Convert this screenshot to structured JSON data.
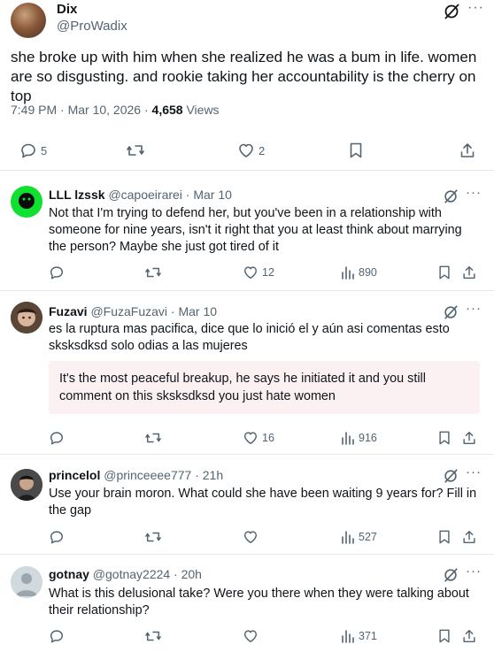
{
  "main": {
    "name": "Dix",
    "handle": "@ProWadix",
    "text": "she broke up with him when she realized he was a bum in life. women are so disgusting. and rookie taking her accountability is the cherry on top",
    "time": "7:49 PM · Mar 10, 2026 · ",
    "views_count": "4,658",
    "views_label": " Views",
    "replies": "5",
    "likes": "2"
  },
  "replies": [
    {
      "name": "LLL lzssk",
      "handle_time": "@capoeirarei · Mar 10",
      "text": "Not that I'm trying to defend her, but you've been in a relationship with someone for nine years, isn't it right that you at least think about marrying the person? Maybe she just got tired of it",
      "likes": "12",
      "views": "890"
    },
    {
      "name": "Fuzavi",
      "handle_time": "@FuzaFuzavi · Mar 10",
      "text": "es la ruptura mas pacifica, dice que lo inició el y aún asi comentas esto sksksdksd solo odias a las mujeres",
      "translation": "It's the most peaceful breakup, he says he initiated it and you still comment on this sksksdksd you just hate women",
      "likes": "16",
      "views": "916"
    },
    {
      "name": "princelol",
      "handle_time": "@princeeee777 · 21h",
      "text": "Use your brain moron. What could she have been waiting 9 years for? Fill in the gap",
      "views": "527"
    },
    {
      "name": "gotnay",
      "handle_time": "@gotnay2224 · 20h",
      "text": "What is this delusional take? Were you there when they were talking about their relationship?",
      "views": "371"
    }
  ],
  "icons": {
    "reply": "reply-icon",
    "repost": "repost-icon",
    "like": "like-icon",
    "views": "views-icon",
    "bookmark": "bookmark-icon",
    "share": "share-icon",
    "grok": "grok-icon",
    "more": "more-icon"
  },
  "colors": {
    "text": "#0f1419",
    "muted": "#536471",
    "divider": "#e6e9eb",
    "translation_bg": "#fbf1f2"
  }
}
